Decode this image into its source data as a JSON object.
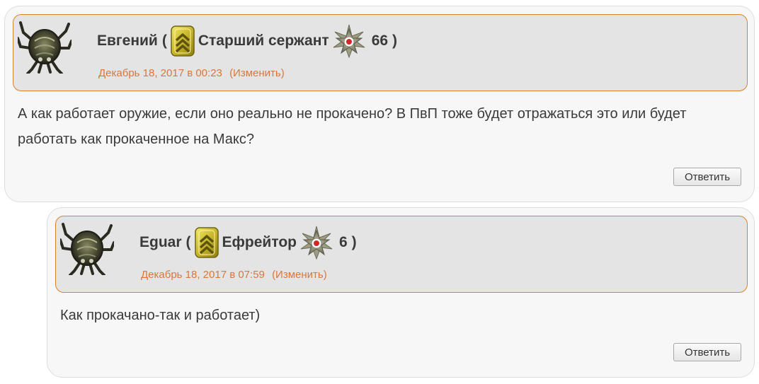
{
  "comments": [
    {
      "author": "Евгений",
      "open_paren": "(",
      "rank": "Старший сержант",
      "level": "66",
      "close_paren": ")",
      "date": "Декабрь 18, 2017 в 00:23",
      "edit_label": "(Изменить)",
      "text": "А как работает оружие, если оно реально не прокачено? В ПвП тоже будет отражаться это или будет работать как прокаченное на Макс?",
      "reply_label": "Ответить"
    },
    {
      "author": "Eguar",
      "open_paren": "(",
      "rank": "Ефрейтор",
      "level": "6",
      "close_paren": ")",
      "date": "Декабрь 18, 2017 в 07:59",
      "edit_label": "(Изменить)",
      "text": "Как прокачано-так и работает)",
      "reply_label": "Ответить"
    }
  ],
  "icons": {
    "avatar": "crab-creature-avatar",
    "rank_badge": "rank-chevron-badge-icon",
    "level_badge": "red-star-medal-icon"
  },
  "colors": {
    "accent": "#d9822b",
    "meta_text": "#d9773a",
    "header_bg": "#e4e4e4",
    "comment_bg": "#f7f7f7",
    "text": "#3a3a3a"
  }
}
